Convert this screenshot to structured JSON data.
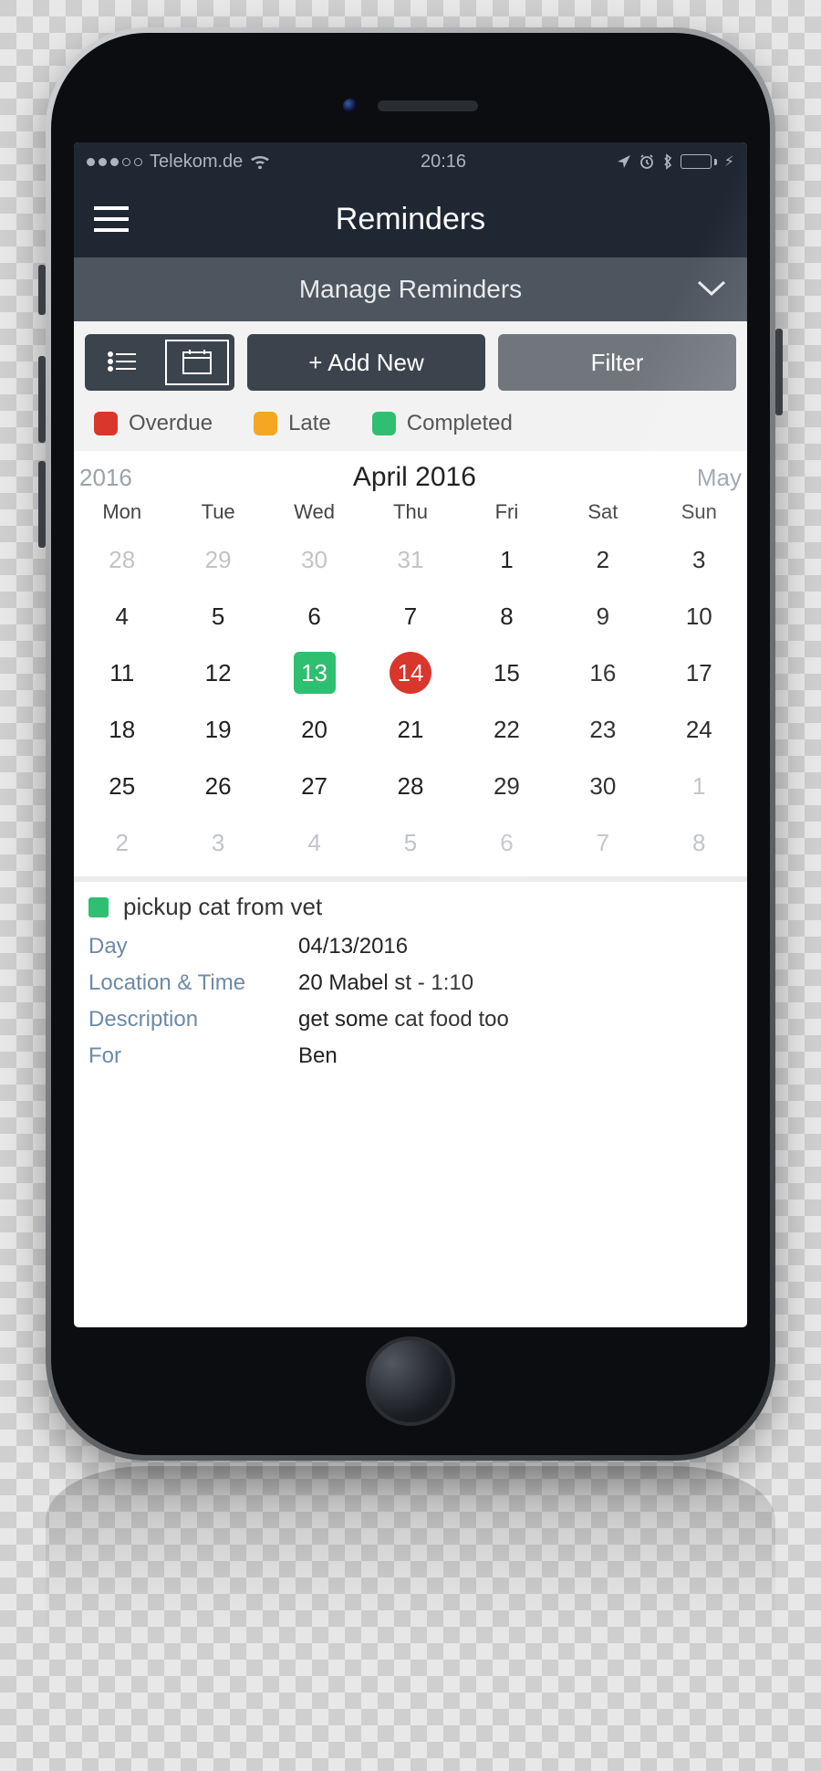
{
  "status": {
    "carrier": "Telekom.de",
    "time": "20:16"
  },
  "header": {
    "title": "Reminders"
  },
  "subheader": {
    "label": "Manage Reminders"
  },
  "toolbar": {
    "add_label": "+ Add New",
    "filter_label": "Filter"
  },
  "legend": {
    "overdue": "Overdue",
    "late": "Late",
    "completed": "Completed"
  },
  "calendar": {
    "prev": "2016",
    "current": "April 2016",
    "next": "May",
    "dow": [
      "Mon",
      "Tue",
      "Wed",
      "Thu",
      "Fri",
      "Sat",
      "Sun"
    ],
    "cells": [
      {
        "n": "28",
        "dim": true
      },
      {
        "n": "29",
        "dim": true
      },
      {
        "n": "30",
        "dim": true
      },
      {
        "n": "31",
        "dim": true
      },
      {
        "n": "1"
      },
      {
        "n": "2"
      },
      {
        "n": "3"
      },
      {
        "n": "4"
      },
      {
        "n": "5"
      },
      {
        "n": "6"
      },
      {
        "n": "7"
      },
      {
        "n": "8"
      },
      {
        "n": "9"
      },
      {
        "n": "10"
      },
      {
        "n": "11"
      },
      {
        "n": "12"
      },
      {
        "n": "13",
        "badge": "green"
      },
      {
        "n": "14",
        "badge": "red"
      },
      {
        "n": "15"
      },
      {
        "n": "16"
      },
      {
        "n": "17"
      },
      {
        "n": "18"
      },
      {
        "n": "19"
      },
      {
        "n": "20"
      },
      {
        "n": "21"
      },
      {
        "n": "22"
      },
      {
        "n": "23"
      },
      {
        "n": "24"
      },
      {
        "n": "25"
      },
      {
        "n": "26"
      },
      {
        "n": "27"
      },
      {
        "n": "28"
      },
      {
        "n": "29"
      },
      {
        "n": "30"
      },
      {
        "n": "1",
        "dim": true
      },
      {
        "n": "2",
        "dim": true
      },
      {
        "n": "3",
        "dim": true
      },
      {
        "n": "4",
        "dim": true
      },
      {
        "n": "5",
        "dim": true
      },
      {
        "n": "6",
        "dim": true
      },
      {
        "n": "7",
        "dim": true
      },
      {
        "n": "8",
        "dim": true
      }
    ]
  },
  "event": {
    "title": "pickup cat from vet",
    "fields": {
      "day_label": "Day",
      "day_value": "04/13/2016",
      "loc_label": "Location & Time",
      "loc_value": "20 Mabel st - 1:10",
      "desc_label": "Description",
      "desc_value": "get some cat food too",
      "for_label": "For",
      "for_value": "Ben"
    }
  }
}
